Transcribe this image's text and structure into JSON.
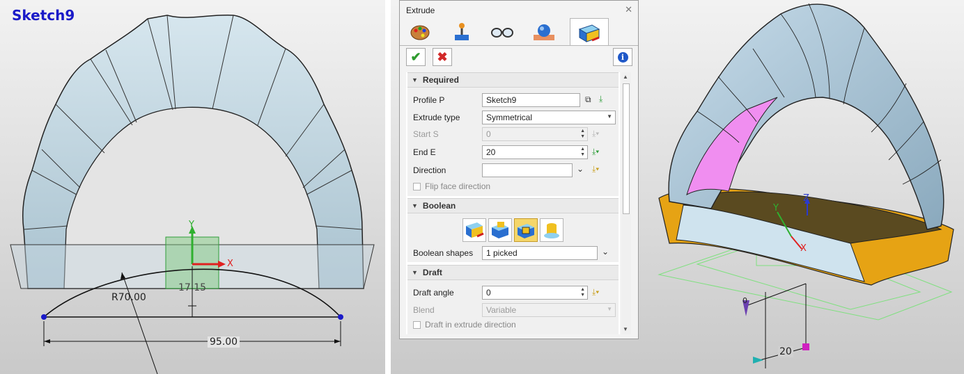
{
  "left_view": {
    "sketch_title": "Sketch9",
    "dim_radius": "R70.00",
    "dim_width": "95.00",
    "dim_height": "17.15",
    "axis_x": "X",
    "axis_y": "Y"
  },
  "right_view": {
    "axis_x": "X",
    "axis_y": "Y",
    "axis_z": "Z",
    "dim_value": "20",
    "small_label": "0",
    "face_color": "#b3cfe1",
    "highlight_face_color": "#f08ef0",
    "base_color": "#e6a314"
  },
  "dialog": {
    "title": "Extrude",
    "close_icon": "close-icon",
    "tabs": [
      {
        "icon": "palette-icon"
      },
      {
        "icon": "joystick-icon"
      },
      {
        "icon": "glasses-icon"
      },
      {
        "icon": "sphere-icon"
      },
      {
        "icon": "extrude-icon"
      }
    ],
    "ok_icon": "checkmark-icon",
    "cancel_icon": "cancel-x-icon",
    "info_icon": "info-icon",
    "required": {
      "header": "Required",
      "profile_label": "Profile P",
      "profile_value": "Sketch9",
      "extrude_type_label": "Extrude type",
      "extrude_type_value": "Symmetrical",
      "start_label": "Start S",
      "start_value": "0",
      "end_label": "End E",
      "end_value": "20",
      "direction_label": "Direction",
      "direction_value": "",
      "flip_label": "Flip face direction",
      "flip_checked": false
    },
    "boolean": {
      "header": "Boolean",
      "ops": [
        "base-icon",
        "add-icon",
        "remove-icon",
        "intersect-icon"
      ],
      "active_op": 2,
      "shapes_label": "Boolean shapes",
      "shapes_value": "1 picked"
    },
    "draft": {
      "header": "Draft",
      "angle_label": "Draft angle",
      "angle_value": "0",
      "blend_label": "Blend",
      "blend_value": "Variable",
      "extrude_dir_label": "Draft in extrude direction",
      "extrude_dir_checked": false
    },
    "colors": {
      "ok_green": "#2e9b2e",
      "cancel_red": "#d22a2a",
      "info_blue": "#1f58c8",
      "pick_green": "#2f9e3a"
    }
  }
}
